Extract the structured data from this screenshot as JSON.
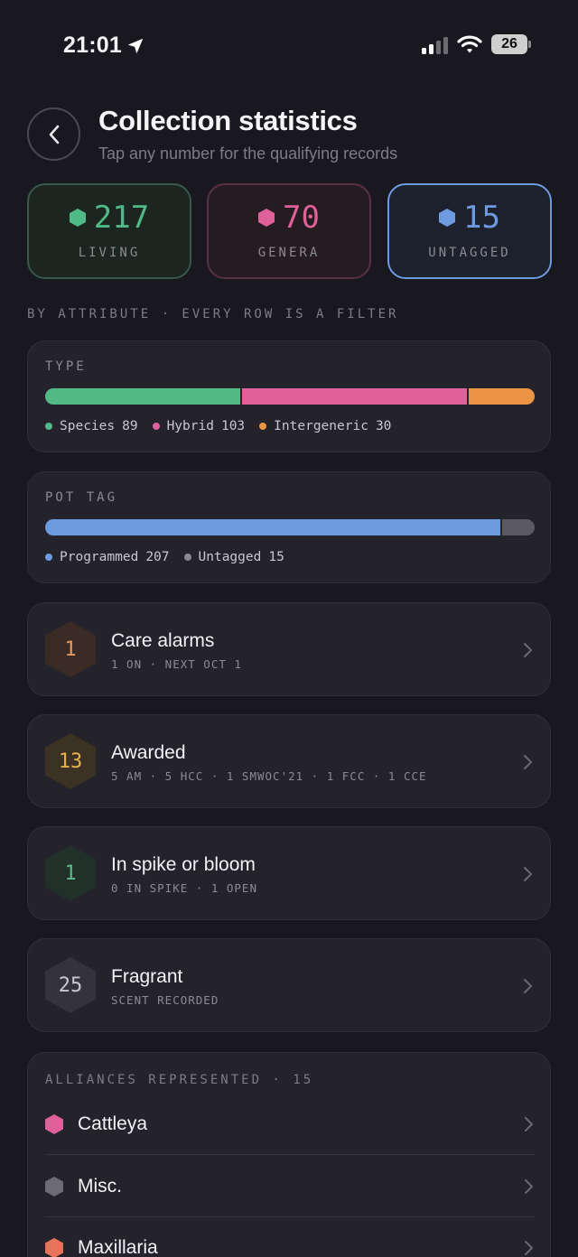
{
  "status": {
    "time": "21:01",
    "battery": "26"
  },
  "header": {
    "title": "Collection statistics",
    "subtitle": "Tap any number for the qualifying records"
  },
  "stats": [
    {
      "value": "217",
      "label": "LIVING",
      "color": "#4fb987"
    },
    {
      "value": "70",
      "label": "GENERA",
      "color": "#e0609a"
    },
    {
      "value": "15",
      "label": "UNTAGGED",
      "color": "#6e9be0"
    }
  ],
  "section_label": "BY ATTRIBUTE · EVERY ROW IS A FILTER",
  "type_card": {
    "title": "TYPE",
    "segments": [
      {
        "name": "Species",
        "count": "89",
        "value": 89,
        "color": "#52b985"
      },
      {
        "name": "Hybrid",
        "count": "103",
        "value": 103,
        "color": "#e0609a"
      },
      {
        "name": "Intergeneric",
        "count": "30",
        "value": 30,
        "color": "#ec9446"
      }
    ]
  },
  "pot_card": {
    "title": "POT TAG",
    "segments": [
      {
        "name": "Programmed",
        "count": "207",
        "value": 207,
        "color": "#6e9be0"
      },
      {
        "name": "Untagged",
        "count": "15",
        "value": 15,
        "color": "#5a595f"
      }
    ]
  },
  "rows": [
    {
      "count": "1",
      "title": "Care alarms",
      "subtitle": "1 ON · NEXT OCT 1",
      "hex_bg": "#3a2b24",
      "hex_fg": "#e59a5c"
    },
    {
      "count": "13",
      "title": "Awarded",
      "subtitle": "5 AM · 5 HCC · 1 SMWOC'21 · 1 FCC · 1 CCE",
      "hex_bg": "#3b3223",
      "hex_fg": "#e6b24c"
    },
    {
      "count": "1",
      "title": "In spike or bloom",
      "subtitle": "0 IN SPIKE · 1 OPEN",
      "hex_bg": "#213029",
      "hex_fg": "#5bb98b"
    },
    {
      "count": "25",
      "title": "Fragrant",
      "subtitle": "SCENT RECORDED",
      "hex_bg": "#34333a",
      "hex_fg": "#c9c8ce"
    }
  ],
  "alliances": {
    "title": "ALLIANCES REPRESENTED · 15",
    "items": [
      {
        "name": "Cattleya",
        "color": "#e0609a"
      },
      {
        "name": "Misc.",
        "color": "#6d6c72"
      },
      {
        "name": "Maxillaria",
        "color": "#e9735a"
      }
    ]
  }
}
